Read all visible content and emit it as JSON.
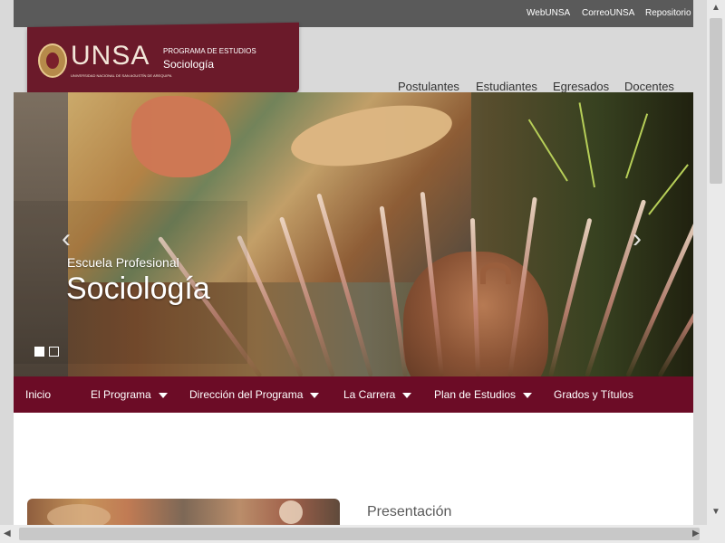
{
  "topbar": {
    "links": [
      "WebUNSA",
      "CorreoUNSA",
      "Repositorio"
    ]
  },
  "brand": {
    "logo": "UNSA",
    "subtitle": "UNIVERSIDAD NACIONAL DE SAN AGUSTÍN DE AREQUIPA",
    "program_label": "PROGRAMA DE ESTUDIOS",
    "program_name": "Sociología"
  },
  "main_nav": [
    "Postulantes",
    "Estudiantes",
    "Egresados",
    "Docentes"
  ],
  "hero": {
    "subtitle": "Escuela Profesional",
    "title": "Sociología",
    "left_arrow": "‹",
    "right_arrow": "›"
  },
  "menu": [
    {
      "label": "Inicio",
      "has_dropdown": false
    },
    {
      "label": "El Programa",
      "has_dropdown": true
    },
    {
      "label": "Dirección del Programa",
      "has_dropdown": true
    },
    {
      "label": "La Carrera",
      "has_dropdown": true
    },
    {
      "label": "Plan de Estudios",
      "has_dropdown": true
    },
    {
      "label": "Grados y Títulos",
      "has_dropdown": false
    }
  ],
  "content": {
    "presentation_title": "Presentación"
  },
  "scrollbars": {
    "up": "▲",
    "down": "▼",
    "left": "◀",
    "right": "▶"
  }
}
